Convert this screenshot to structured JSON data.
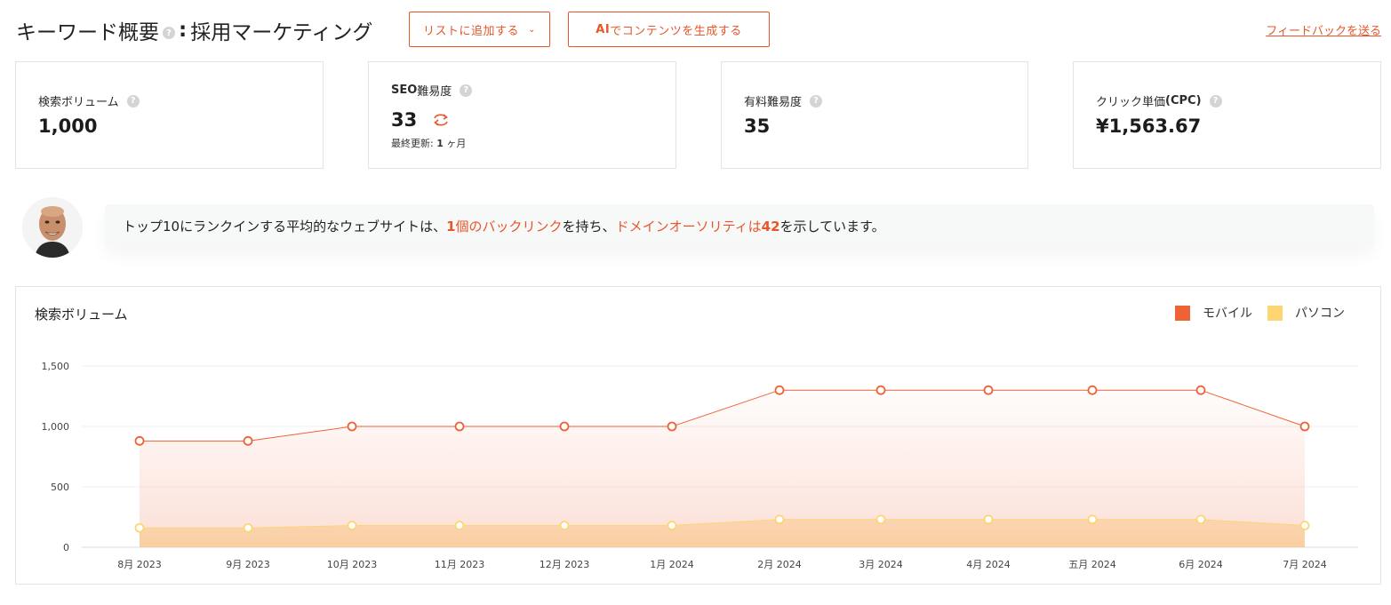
{
  "header": {
    "title": "キーワード概要",
    "help": "?",
    "colon": ":",
    "keyword": "採用マーケティング",
    "add_to_list": "リストに追加する",
    "add_to_list_chevron": "⌄",
    "ai_prefix": "AI",
    "ai_suffix": "でコンテンツを生成する",
    "feedback": "フィードバックを送る"
  },
  "metrics": {
    "volume": {
      "label": "検索ボリューム",
      "help": "?",
      "value": "1,000"
    },
    "seo": {
      "label_prefix": "SEO",
      "label_suffix": "難易度",
      "help": "?",
      "value": "33",
      "updated_label": "最終更新:",
      "updated_num": "1",
      "updated_unit": "ヶ月"
    },
    "paid": {
      "label": "有料難易度",
      "help": "?",
      "value": "35"
    },
    "cpc": {
      "label_prefix": "クリック単価",
      "label_suffix": "(CPC)",
      "help": "?",
      "value": "¥1,563.67"
    }
  },
  "insight": {
    "p1": "トップ10にランクインする平均的なウェブサイトは、",
    "h1_num": "1",
    "h1_text": "個のバックリンク",
    "p2": "を持ち、",
    "h2_text": "ドメインオーソリティは",
    "h2_num": "42",
    "p3": "を示しています。"
  },
  "colors": {
    "accent": "#e8562a",
    "mobile": "#ee6236",
    "desktop": "#fdd573"
  },
  "chart_data": {
    "type": "area",
    "title": "検索ボリューム",
    "categories": [
      "8月 2023",
      "9月 2023",
      "10月 2023",
      "11月 2023",
      "12月 2023",
      "1月 2024",
      "2月 2024",
      "3月 2024",
      "4月 2024",
      "五月 2024",
      "6月 2024",
      "7月 2024"
    ],
    "series": [
      {
        "name": "モバイル",
        "color": "#ee6236",
        "values": [
          880,
          880,
          1000,
          1000,
          1000,
          1000,
          1300,
          1300,
          1300,
          1300,
          1300,
          1000
        ]
      },
      {
        "name": "パソコン",
        "color": "#fdd573",
        "values": [
          160,
          160,
          180,
          180,
          180,
          180,
          230,
          230,
          230,
          230,
          230,
          180
        ]
      }
    ],
    "yticks": [
      0,
      500,
      1000,
      1500
    ],
    "ytick_labels": [
      "0",
      "500",
      "1,000",
      "1,500"
    ],
    "ylim": [
      0,
      1500
    ],
    "grid": true,
    "legend_position": "top-right"
  }
}
